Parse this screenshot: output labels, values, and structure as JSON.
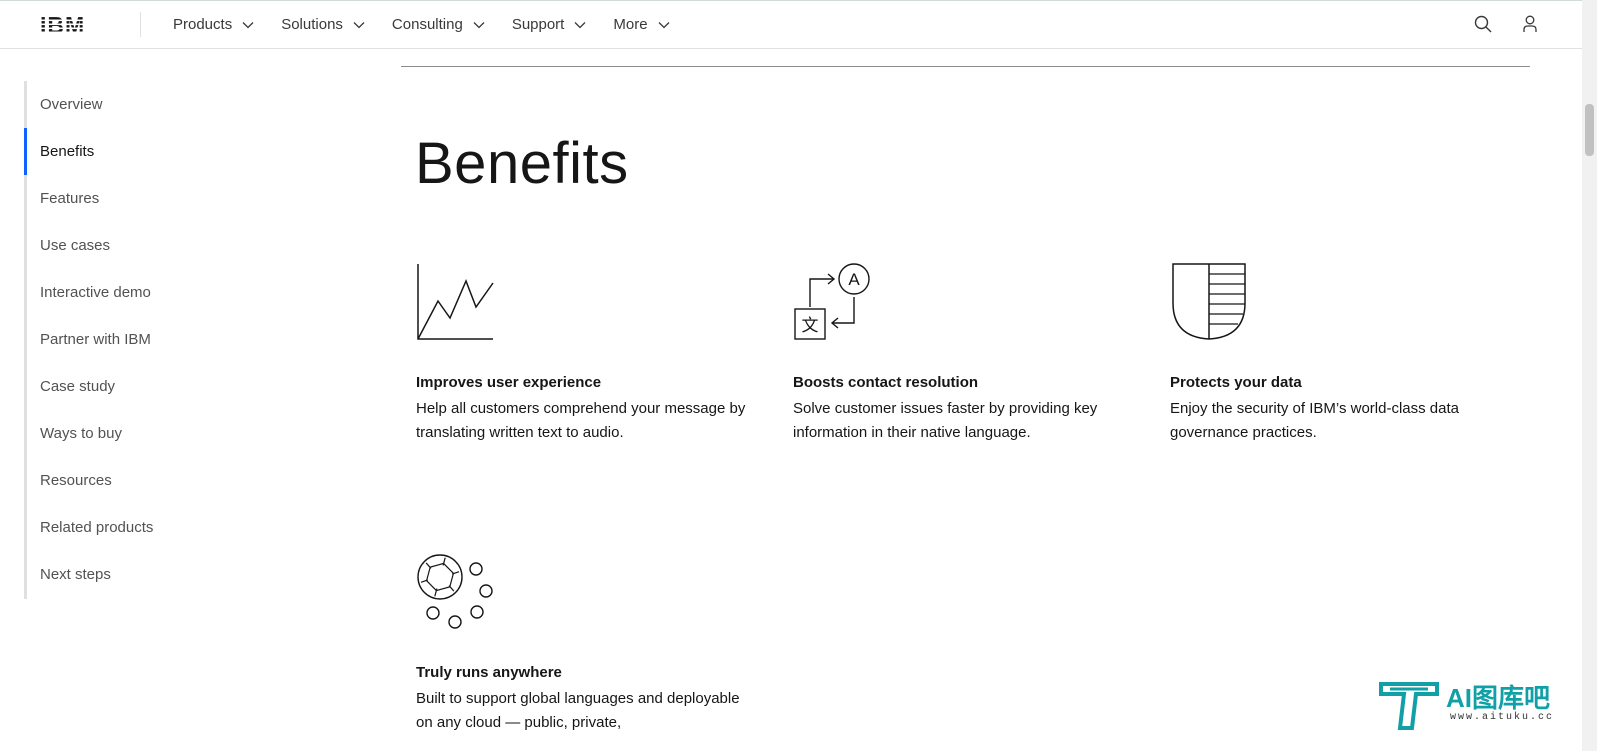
{
  "header": {
    "logo_text": "IBM",
    "nav": [
      {
        "label": "Products"
      },
      {
        "label": "Solutions"
      },
      {
        "label": "Consulting"
      },
      {
        "label": "Support"
      },
      {
        "label": "More"
      }
    ],
    "icons": [
      "search-icon",
      "user-icon"
    ]
  },
  "sidenav": {
    "items": [
      {
        "label": "Overview"
      },
      {
        "label": "Benefits"
      },
      {
        "label": "Features"
      },
      {
        "label": "Use cases"
      },
      {
        "label": "Interactive demo"
      },
      {
        "label": "Partner with IBM"
      },
      {
        "label": "Case study"
      },
      {
        "label": "Ways to buy"
      },
      {
        "label": "Resources"
      },
      {
        "label": "Related products"
      },
      {
        "label": "Next steps"
      }
    ],
    "active": "Benefits",
    "active_color": "#0f62fe"
  },
  "main": {
    "title": "Benefits",
    "benefits": [
      {
        "icon": "chart-line-icon",
        "title": "Improves user experience",
        "desc": "Help all customers comprehend your message by translating written text to audio."
      },
      {
        "icon": "translate-icon",
        "title": "Boosts contact resolution",
        "desc": "Solve customer issues faster by providing key information in their native language."
      },
      {
        "icon": "shield-icon",
        "title": "Protects your data",
        "desc": "Enjoy the security of IBM’s world-class data governance practices."
      },
      {
        "icon": "cloud-network-icon",
        "title": "Truly runs anywhere",
        "desc": "Built to support global languages and deployable on any cloud — public, private,"
      }
    ]
  },
  "watermark": {
    "text": "AI图库吧",
    "url": "www.aituku.cc",
    "color": "#12a0a8"
  }
}
